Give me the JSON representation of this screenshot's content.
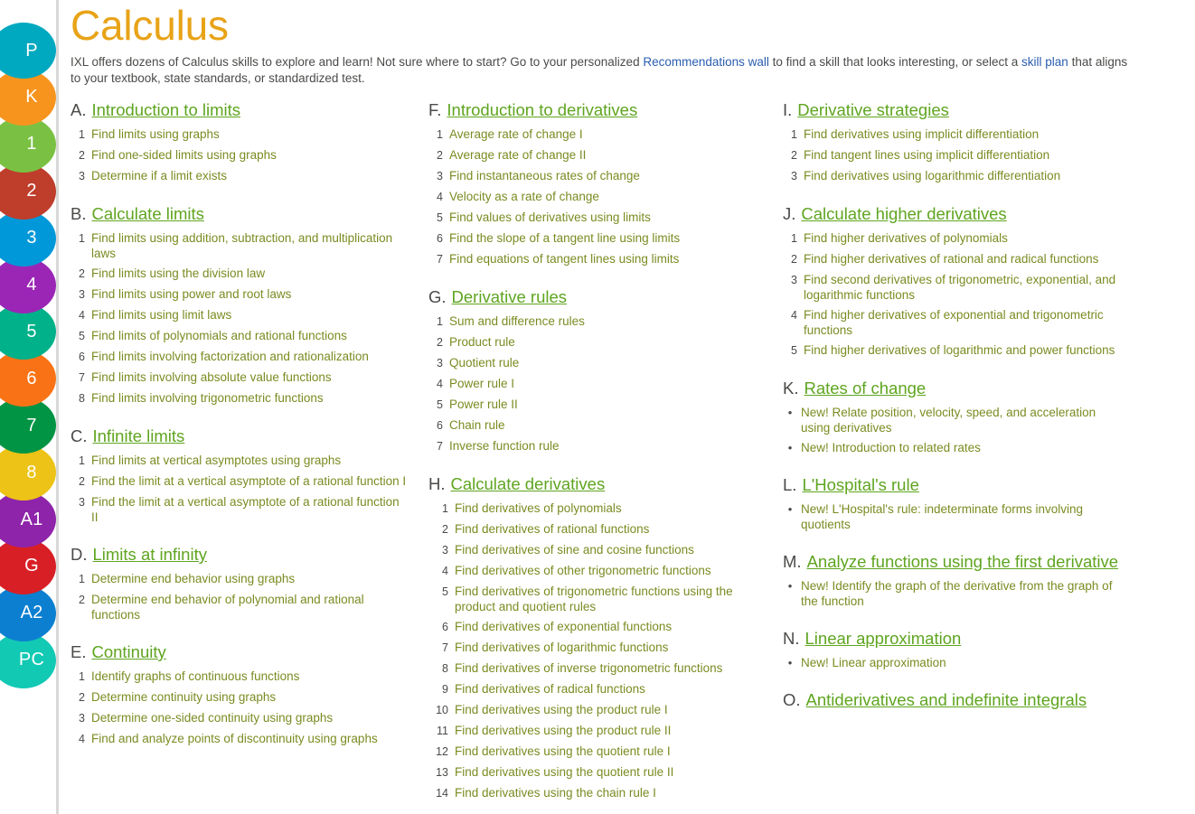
{
  "page": {
    "title": "Calculus",
    "intro": {
      "part1": "IXL offers dozens of Calculus skills to explore and learn! Not sure where to start? Go to your personalized ",
      "link1": "Recommendations wall",
      "part2": " to find a skill that looks interesting, or select a ",
      "link2": "skill plan",
      "part3": " that aligns to your textbook, state standards, or standardized test."
    }
  },
  "colors": {
    "title": "#e8a317",
    "section_title": "#5fa520",
    "section_letter": "#4a4a48",
    "skill_link": "#7a8c22",
    "intro_link": "#2a5db0",
    "body_text": "#4a4a48",
    "divider": "#d8d8d6"
  },
  "grade_rail": {
    "items": [
      {
        "label": "P",
        "color": "#00a9c0",
        "name": "pre-k"
      },
      {
        "label": "K",
        "color": "#f7941e",
        "name": "kindergarten"
      },
      {
        "label": "1",
        "color": "#7ac143",
        "name": "grade-1"
      },
      {
        "label": "2",
        "color": "#bf3d2b",
        "name": "grade-2"
      },
      {
        "label": "3",
        "color": "#0098d8",
        "name": "grade-3"
      },
      {
        "label": "4",
        "color": "#9b26b6",
        "name": "grade-4"
      },
      {
        "label": "5",
        "color": "#00b189",
        "name": "grade-5"
      },
      {
        "label": "6",
        "color": "#f97316",
        "name": "grade-6"
      },
      {
        "label": "7",
        "color": "#009444",
        "name": "grade-7"
      },
      {
        "label": "8",
        "color": "#ecc316",
        "name": "grade-8"
      },
      {
        "label": "A1",
        "color": "#8e24aa",
        "name": "algebra-1"
      },
      {
        "label": "G",
        "color": "#d81f26",
        "name": "geometry"
      },
      {
        "label": "A2",
        "color": "#0c7fd0",
        "name": "algebra-2"
      },
      {
        "label": "PC",
        "color": "#12c9b4",
        "name": "precalculus"
      }
    ]
  },
  "columns": [
    {
      "sections": [
        {
          "letter": "A.",
          "title": "Introduction to limits",
          "list_type": "numbered",
          "skills": [
            "Find limits using graphs",
            "Find one-sided limits using graphs",
            "Determine if a limit exists"
          ]
        },
        {
          "letter": "B.",
          "title": "Calculate limits",
          "list_type": "numbered",
          "skills": [
            "Find limits using addition, subtraction, and multiplication laws",
            "Find limits using the division law",
            "Find limits using power and root laws",
            "Find limits using limit laws",
            "Find limits of polynomials and rational functions",
            "Find limits involving factorization and rationalization",
            "Find limits involving absolute value functions",
            "Find limits involving trigonometric functions"
          ]
        },
        {
          "letter": "C.",
          "title": "Infinite limits",
          "list_type": "numbered",
          "skills": [
            "Find limits at vertical asymptotes using graphs",
            "Find the limit at a vertical asymptote of a rational function I",
            "Find the limit at a vertical asymptote of a rational function II"
          ]
        },
        {
          "letter": "D.",
          "title": "Limits at infinity",
          "list_type": "numbered",
          "skills": [
            "Determine end behavior using graphs",
            "Determine end behavior of polynomial and rational functions"
          ]
        },
        {
          "letter": "E.",
          "title": "Continuity",
          "list_type": "numbered",
          "skills": [
            "Identify graphs of continuous functions",
            "Determine continuity using graphs",
            "Determine one-sided continuity using graphs",
            "Find and analyze points of discontinuity using graphs"
          ]
        }
      ]
    },
    {
      "sections": [
        {
          "letter": "F.",
          "title": "Introduction to derivatives",
          "list_type": "numbered",
          "skills": [
            "Average rate of change I",
            "Average rate of change II",
            "Find instantaneous rates of change",
            "Velocity as a rate of change",
            "Find values of derivatives using limits",
            "Find the slope of a tangent line using limits",
            "Find equations of tangent lines using limits"
          ]
        },
        {
          "letter": "G.",
          "title": "Derivative rules",
          "list_type": "numbered",
          "skills": [
            "Sum and difference rules",
            "Product rule",
            "Quotient rule",
            "Power rule I",
            "Power rule II",
            "Chain rule",
            "Inverse function rule"
          ]
        },
        {
          "letter": "H.",
          "title": "Calculate derivatives",
          "list_type": "numbered",
          "skills": [
            "Find derivatives of polynomials",
            "Find derivatives of rational functions",
            "Find derivatives of sine and cosine functions",
            "Find derivatives of other trigonometric functions",
            "Find derivatives of trigonometric functions using the product and quotient rules",
            "Find derivatives of exponential functions",
            "Find derivatives of logarithmic functions",
            "Find derivatives of inverse trigonometric functions",
            "Find derivatives of radical functions",
            "Find derivatives using the product rule I",
            "Find derivatives using the product rule II",
            "Find derivatives using the quotient rule I",
            "Find derivatives using the quotient rule II",
            "Find derivatives using the chain rule I"
          ]
        }
      ]
    },
    {
      "sections": [
        {
          "letter": "I.",
          "title": "Derivative strategies",
          "list_type": "numbered",
          "skills": [
            "Find derivatives using implicit differentiation",
            "Find tangent lines using implicit differentiation",
            "Find derivatives using logarithmic differentiation"
          ]
        },
        {
          "letter": "J.",
          "title": "Calculate higher derivatives",
          "list_type": "numbered",
          "skills": [
            "Find higher derivatives of polynomials",
            "Find higher derivatives of rational and radical functions",
            "Find second derivatives of trigonometric, exponential, and logarithmic functions",
            "Find higher derivatives of exponential and trigonometric functions",
            "Find higher derivatives of logarithmic and power functions"
          ]
        },
        {
          "letter": "K.",
          "title": "Rates of change",
          "list_type": "bulleted",
          "skills": [
            "New! Relate position, velocity, speed, and acceleration using derivatives",
            "New! Introduction to related rates"
          ]
        },
        {
          "letter": "L.",
          "title": "L'Hospital's rule",
          "list_type": "bulleted",
          "skills": [
            "New! L'Hospital's rule: indeterminate forms involving quotients"
          ]
        },
        {
          "letter": "M.",
          "title": "Analyze functions using the first derivative",
          "list_type": "bulleted",
          "skills": [
            "New! Identify the graph of the derivative from the graph of the function"
          ]
        },
        {
          "letter": "N.",
          "title": "Linear approximation",
          "list_type": "bulleted",
          "skills": [
            "New! Linear approximation"
          ]
        },
        {
          "letter": "O.",
          "title": "Antiderivatives and indefinite integrals",
          "list_type": "bulleted",
          "skills": []
        }
      ]
    }
  ]
}
